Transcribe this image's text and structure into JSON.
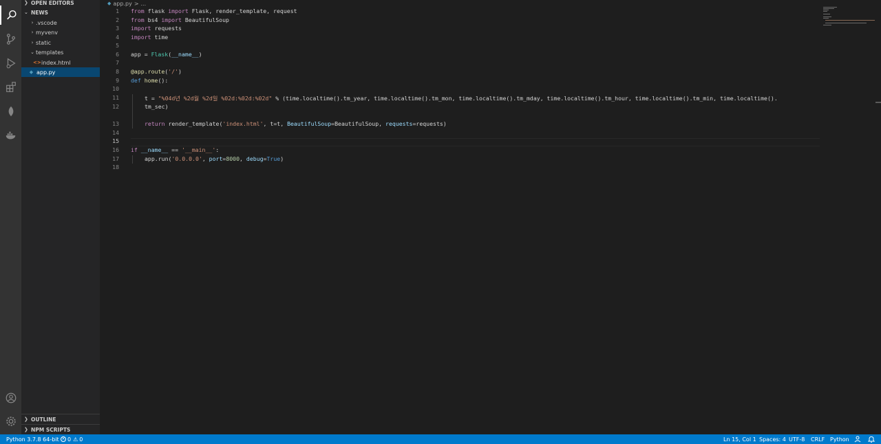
{
  "sidebar": {
    "open_editors": "OPEN EDITORS",
    "workspace": "NEWS",
    "items": [
      {
        "label": ".vscode"
      },
      {
        "label": "myvenv"
      },
      {
        "label": "static"
      },
      {
        "label": "templates"
      },
      {
        "label": "index.html"
      },
      {
        "label": "app.py"
      }
    ],
    "outline": "OUTLINE",
    "npm_scripts": "NPM SCRIPTS"
  },
  "breadcrumb": {
    "file": "app.py",
    "sep": ">",
    "more": "..."
  },
  "code": {
    "line_numbers": [
      "1",
      "2",
      "3",
      "4",
      "5",
      "6",
      "7",
      "8",
      "9",
      "10",
      "11",
      "",
      "12",
      "13",
      "14",
      "15",
      "16",
      "17",
      "18"
    ],
    "l1": {
      "from": "from",
      "mod": " flask ",
      "imp": "import",
      "rest": " Flask, render_template, request"
    },
    "l2": {
      "from": "from",
      "mod": " bs4 ",
      "imp": "import",
      "rest": " BeautifulSoup"
    },
    "l3": {
      "imp": "import",
      "rest": " requests"
    },
    "l4": {
      "imp": "import",
      "rest": " time"
    },
    "l6": {
      "a": "app = ",
      "fn": "Flask",
      "p1": "(",
      "var": "__name__",
      "p2": ")"
    },
    "l8": {
      "dec": "@app.route",
      "p1": "(",
      "str": "'/'",
      "p2": ")"
    },
    "l9": {
      "def": "def",
      "sp": " ",
      "fn": "home",
      "rest": "():"
    },
    "l11": {
      "a": "t = ",
      "str": "\"%04d년 %2d월 %2d일 %02d:%02d:%02d\"",
      "b": " % (time.localtime().tm_year, time.localtime().tm_mon, time.localtime().tm_mday, time.localtime().tm_hour, time.localtime().tm_min, time.localtime()."
    },
    "l11b": "tm_sec)",
    "l13": {
      "ret": "return",
      "a": " render_template(",
      "str": "'index.html'",
      "b": ", t=t, ",
      "cls": "BeautifulSoup",
      "c": "=BeautifulSoup, ",
      "var": "requests",
      "d": "=requests)"
    },
    "l16": {
      "if": "if",
      "a": " ",
      "var": "__name__",
      "b": " == ",
      "str": "'__main__'",
      "c": ":"
    },
    "l17": {
      "a": "app.run(",
      "str": "'0.0.0.0'",
      "b": ", ",
      "port": "port",
      "c": "=",
      "num": "8000",
      "d": ", ",
      "debug": "debug",
      "e": "=",
      "true": "True",
      "f": ")"
    }
  },
  "status": {
    "python": "Python 3.7.8 64-bit",
    "errors": "0",
    "warnings": "0",
    "position": "Ln 15, Col 1",
    "spaces": "Spaces: 4",
    "encoding": "UTF-8",
    "eol": "CRLF",
    "language": "Python"
  },
  "colors": {
    "status_bar": "#007acc",
    "selected": "#094771",
    "keyword": "#c586c0",
    "string": "#ce9178"
  }
}
